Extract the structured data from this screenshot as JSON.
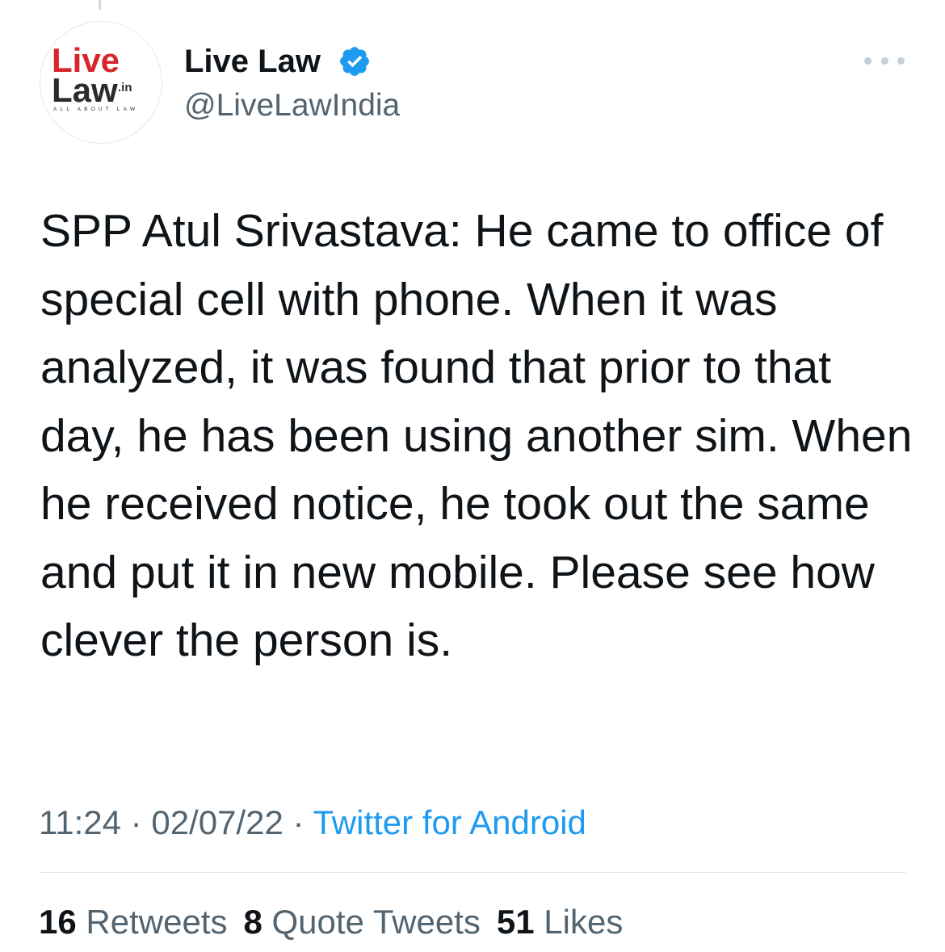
{
  "tweet": {
    "author": {
      "display_name": "Live Law",
      "handle": "@LiveLawIndia",
      "verified": true,
      "avatar": {
        "logo_line1": "Live",
        "logo_line2": "Law",
        "logo_suffix": ".in",
        "logo_tagline": "ALL ABOUT LAW"
      }
    },
    "text": "SPP Atul Srivastava: He came to office of special cell with phone. When it was analyzed, it was found that prior to that day, he has been using another sim. When he received notice, he took out the same and put it in new mobile. Please see how clever the person is.",
    "time": "11:24",
    "date": "02/07/22",
    "separator": "·",
    "source": "Twitter for Android",
    "stats": {
      "retweets_count": "16",
      "retweets_label": "Retweets",
      "quote_tweets_count": "8",
      "quote_tweets_label": "Quote Tweets",
      "likes_count": "51",
      "likes_label": "Likes"
    }
  },
  "icons": {
    "verified": "verified-badge-icon",
    "more": "more-options-icon"
  },
  "colors": {
    "logo_red": "#d7262b",
    "logo_dark": "#2b2b2b",
    "verified_blue": "#1d9bf0",
    "link_blue": "#1d9bf0",
    "secondary_gray": "#536471",
    "text_dark": "#0f1419"
  }
}
